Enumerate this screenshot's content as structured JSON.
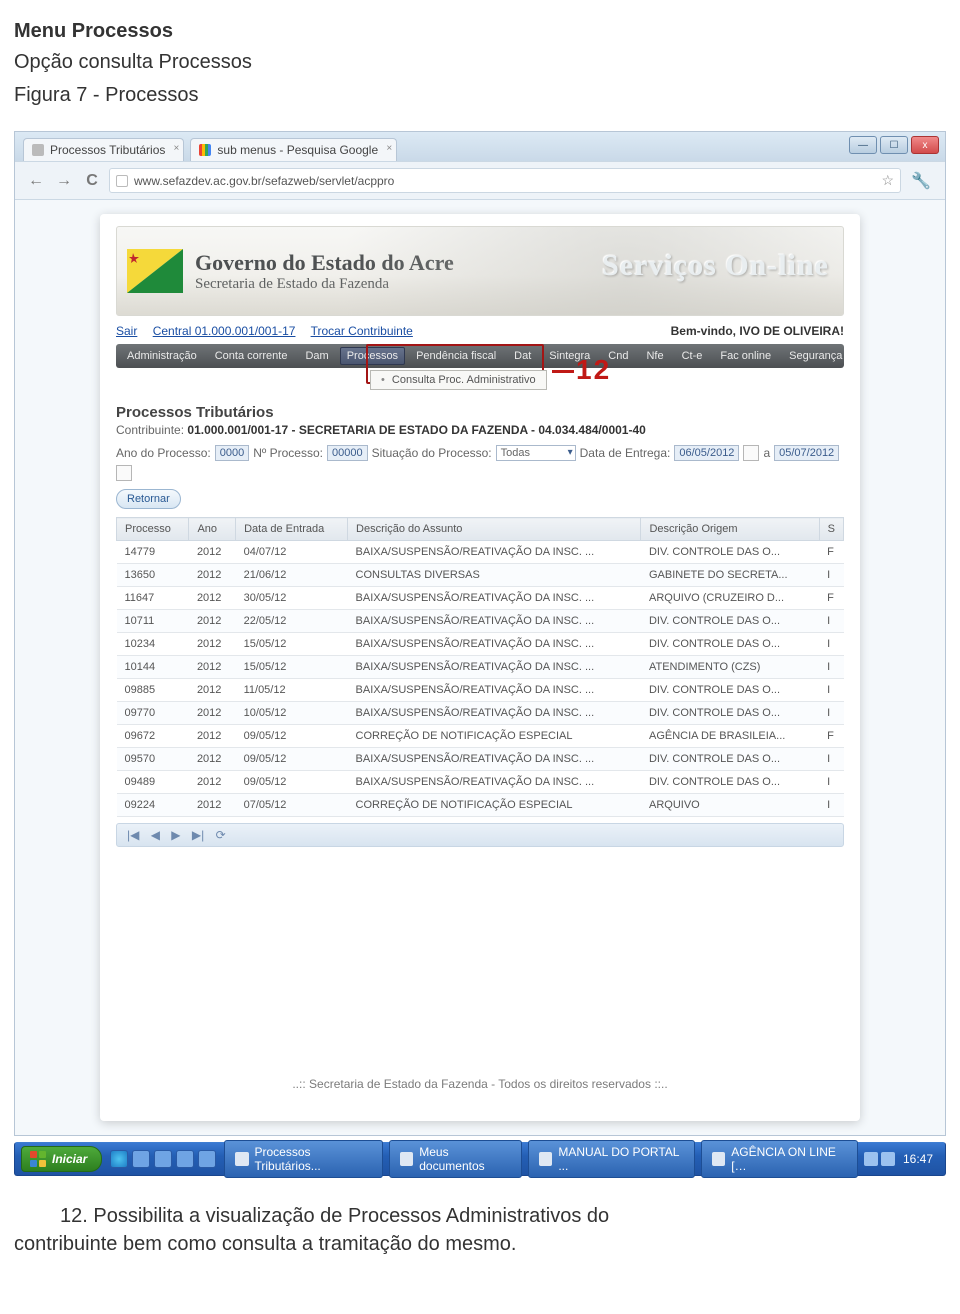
{
  "doc": {
    "heading": "Menu Processos",
    "subtitle": "Opção consulta Processos",
    "caption": "Figura 7 - Processos",
    "footnote_line1": "12. Possibilita a visualização de Processos Administrativos do",
    "footnote_line2": "contribuinte bem como consulta a tramitação do mesmo."
  },
  "browser": {
    "tabs": [
      {
        "title": "Processos Tributários"
      },
      {
        "title": "sub menus - Pesquisa Google"
      }
    ],
    "url": "www.sefazdev.ac.gov.br/sefazweb/servlet/acppro",
    "window_controls": {
      "minimize": "—",
      "maximize": "☐",
      "close": "x"
    }
  },
  "header": {
    "title": "Governo do Estado do Acre",
    "subtitle": "Secretaria de Estado da Fazenda",
    "services_banner": "Serviços On-line"
  },
  "top_links": {
    "sair": "Sair",
    "central": "Central 01.000.001/001-17",
    "trocar": "Trocar Contribuinte",
    "welcome": "Bem-vindo, IVO DE OLIVEIRA!"
  },
  "menu": {
    "items": [
      "Administração",
      "Conta corrente",
      "Dam",
      "Processos",
      "Pendência fiscal",
      "Dat",
      "Sintegra",
      "Cnd",
      "Nfe",
      "Ct-e",
      "Fac online",
      "Segurança"
    ],
    "active_item": "Processos",
    "submenu_label": "Consulta Proc. Administrativo",
    "callout_number": "12"
  },
  "section": {
    "title": "Processos Tributários",
    "contribuinte_label": "Contribuinte:",
    "contribuinte_value": "01.000.001/001-17 - SECRETARIA DE ESTADO DA FAZENDA - 04.034.484/0001-40"
  },
  "filters": {
    "ano_label": "Ano do Processo:",
    "ano_value": "0000",
    "numero_label": "Nº Processo:",
    "numero_value": "00000",
    "situacao_label": "Situação do Processo:",
    "situacao_value": "Todas",
    "entrega_label": "Data de Entrega:",
    "date_from": "06/05/2012",
    "a": "a",
    "date_to": "05/07/2012",
    "retornar": "Retornar"
  },
  "table": {
    "headers": [
      "Processo",
      "Ano",
      "Data de Entrada",
      "Descrição do Assunto",
      "Descrição Origem",
      "S"
    ],
    "rows": [
      {
        "processo": "14779",
        "ano": "2012",
        "data": "04/07/12",
        "assunto": "BAIXA/SUSPENSÃO/REATIVAÇÃO DA INSC. ...",
        "origem": "DIV. CONTROLE DAS O...",
        "s": "F"
      },
      {
        "processo": "13650",
        "ano": "2012",
        "data": "21/06/12",
        "assunto": "CONSULTAS DIVERSAS",
        "origem": "GABINETE DO SECRETA...",
        "s": "I"
      },
      {
        "processo": "11647",
        "ano": "2012",
        "data": "30/05/12",
        "assunto": "BAIXA/SUSPENSÃO/REATIVAÇÃO DA INSC. ...",
        "origem": "ARQUIVO (CRUZEIRO D...",
        "s": "F"
      },
      {
        "processo": "10711",
        "ano": "2012",
        "data": "22/05/12",
        "assunto": "BAIXA/SUSPENSÃO/REATIVAÇÃO DA INSC. ...",
        "origem": "DIV. CONTROLE DAS O...",
        "s": "I"
      },
      {
        "processo": "10234",
        "ano": "2012",
        "data": "15/05/12",
        "assunto": "BAIXA/SUSPENSÃO/REATIVAÇÃO DA INSC. ...",
        "origem": "DIV. CONTROLE DAS O...",
        "s": "I"
      },
      {
        "processo": "10144",
        "ano": "2012",
        "data": "15/05/12",
        "assunto": "BAIXA/SUSPENSÃO/REATIVAÇÃO DA INSC. ...",
        "origem": "ATENDIMENTO (CZS)",
        "s": "I"
      },
      {
        "processo": "09885",
        "ano": "2012",
        "data": "11/05/12",
        "assunto": "BAIXA/SUSPENSÃO/REATIVAÇÃO DA INSC. ...",
        "origem": "DIV. CONTROLE DAS O...",
        "s": "I"
      },
      {
        "processo": "09770",
        "ano": "2012",
        "data": "10/05/12",
        "assunto": "BAIXA/SUSPENSÃO/REATIVAÇÃO DA INSC. ...",
        "origem": "DIV. CONTROLE DAS O...",
        "s": "I"
      },
      {
        "processo": "09672",
        "ano": "2012",
        "data": "09/05/12",
        "assunto": "CORREÇÃO DE NOTIFICAÇÃO ESPECIAL",
        "origem": "AGÊNCIA DE BRASILEIA...",
        "s": "F"
      },
      {
        "processo": "09570",
        "ano": "2012",
        "data": "09/05/12",
        "assunto": "BAIXA/SUSPENSÃO/REATIVAÇÃO DA INSC. ...",
        "origem": "DIV. CONTROLE DAS O...",
        "s": "I"
      },
      {
        "processo": "09489",
        "ano": "2012",
        "data": "09/05/12",
        "assunto": "BAIXA/SUSPENSÃO/REATIVAÇÃO DA INSC. ...",
        "origem": "DIV. CONTROLE DAS O...",
        "s": "I"
      },
      {
        "processo": "09224",
        "ano": "2012",
        "data": "07/05/12",
        "assunto": "CORREÇÃO DE NOTIFICAÇÃO ESPECIAL",
        "origem": "ARQUIVO",
        "s": "I"
      }
    ]
  },
  "pager": {
    "first": "|◀",
    "prev": "◀",
    "next": "▶",
    "last": "▶|",
    "refresh": "⟳"
  },
  "footer_rights": "..:: Secretaria de Estado da Fazenda - Todos os direitos reservados ::..",
  "taskbar": {
    "start": "Iniciar",
    "tasks": [
      "Processos Tributários...",
      "Meus documentos",
      "MANUAL DO PORTAL ...",
      "AGÊNCIA ON LINE […"
    ],
    "clock": "16:47"
  }
}
